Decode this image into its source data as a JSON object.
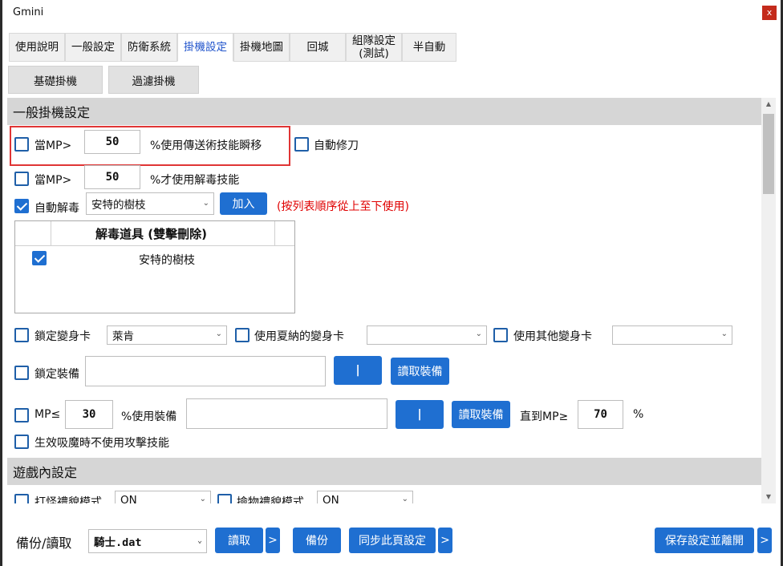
{
  "window": {
    "title": "Gmini",
    "close_glyph": "x"
  },
  "tabs": [
    "使用說明",
    "一般設定",
    "防衛系統",
    "掛機設定",
    "掛機地圖",
    "回城",
    "組隊設定\n(測試)",
    "半自動"
  ],
  "active_tab": "掛機設定",
  "subtabs": [
    "基礎掛機",
    "過濾掛機"
  ],
  "section_general": {
    "title": "一般掛機設定",
    "mp_teleport": {
      "prefix": "當MP>",
      "value": "50",
      "suffix": "%使用傳送術技能瞬移",
      "checked": false
    },
    "auto_repair": {
      "label": "自動修刀",
      "checked": false
    },
    "mp_detox": {
      "prefix": "當MP>",
      "value": "50",
      "suffix": "%才使用解毒技能",
      "checked": false
    },
    "auto_detox": {
      "label": "自動解毒",
      "checked": true,
      "selected": "安特的樹枝",
      "add_button": "加入",
      "note": "(按列表順序從上至下使用)"
    },
    "detox_list": {
      "header": "解毒道具 (雙擊刪除)",
      "items": [
        {
          "name": "安特的樹枝",
          "checked": true
        }
      ]
    },
    "lock_poly": {
      "label": "鎖定變身卡",
      "checked": false,
      "selected": "萊肯"
    },
    "use_shana_poly": {
      "label": "使用夏納的變身卡",
      "checked": false,
      "selected": ""
    },
    "use_other_poly": {
      "label": "使用其他變身卡",
      "checked": false,
      "selected": ""
    },
    "lock_equip": {
      "label": "鎖定裝備",
      "checked": false,
      "value": "",
      "pipe_button": "|",
      "read_button": "讀取裝備"
    },
    "mp_equip": {
      "prefix": "MP≤",
      "value": "30",
      "mid": "%使用裝備",
      "field": "",
      "pipe_button": "|",
      "read_button": "讀取裝備",
      "until_label": "直到MP≥",
      "until_value": "70",
      "pct": "%",
      "checked": false
    },
    "no_attack_skill": {
      "label": "生效吸魔時不使用攻擊技能",
      "checked": false
    }
  },
  "section_game": {
    "title": "遊戲內設定",
    "monster_courtesy": {
      "label": "打怪禮貌模式",
      "selected": "ON",
      "checked": false
    },
    "loot_courtesy": {
      "label": "撿物禮貌模式",
      "selected": "ON",
      "checked": false
    }
  },
  "footer": {
    "backup_label": "備份/讀取",
    "file_selected": "騎士.dat",
    "read_button": "讀取",
    "more_glyph": ">",
    "backup_button": "備份",
    "sync_button": "同步此頁設定",
    "save_exit_button": "保存設定並離開"
  },
  "colors": {
    "accent": "#1f6fd1",
    "active_tab_text": "#2255cc",
    "highlight": "#e03535",
    "note_red": "#e00000",
    "section_bg": "#d6d6d6"
  }
}
